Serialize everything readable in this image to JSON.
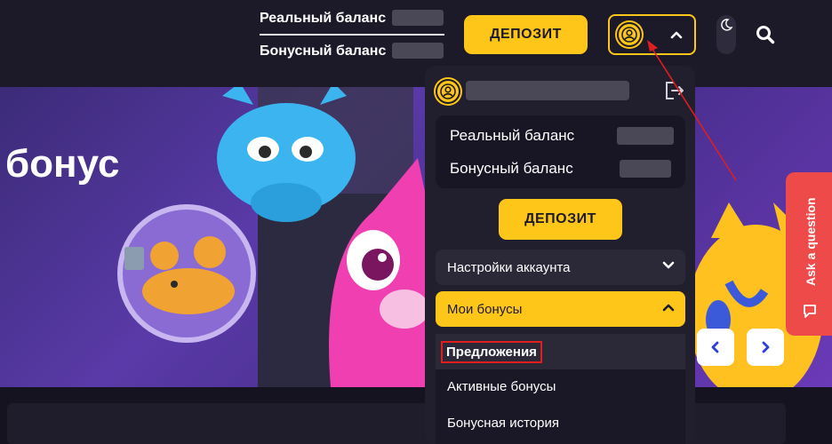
{
  "header": {
    "real_balance_label": "Реальный баланс",
    "bonus_balance_label": "Бонусный баланс",
    "deposit_label": "ДЕПОЗИТ"
  },
  "banner": {
    "title": "бонус",
    "prev_icon": "chevron-left-icon",
    "next_icon": "chevron-right-icon"
  },
  "help": {
    "label": "Ask a question"
  },
  "dropdown": {
    "real_balance_label": "Реальный баланс",
    "bonus_balance_label": "Бонусный баланс",
    "deposit_label": "ДЕПОЗИТ",
    "account_settings": "Настройки аккаунта",
    "my_bonuses": "Мои бонусы",
    "submenu": [
      "Предложения",
      "Активные бонусы",
      "Бонусная история"
    ]
  },
  "colors": {
    "accent": "#ffc61a",
    "panel": "#211f2e",
    "highlight": "#e01e1e",
    "help": "#ef4a4a"
  }
}
